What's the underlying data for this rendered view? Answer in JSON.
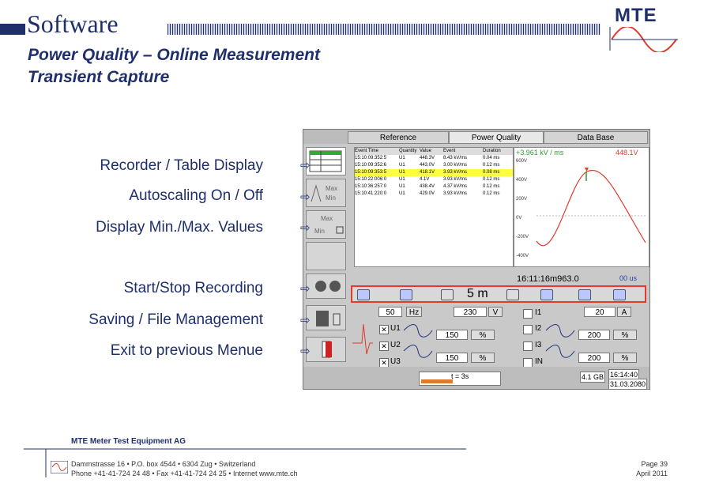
{
  "header": {
    "title": "Software",
    "subtitle_1": "Power Quality – Online Measurement",
    "subtitle_2": "Transient Capture",
    "logo_text": "MTE"
  },
  "feature_labels": [
    "Recorder / Table Display",
    "Autoscaling On / Off",
    "Display Min./Max. Values",
    "Start/Stop Recording",
    "Saving / File Management",
    "Exit to previous Menue"
  ],
  "screen": {
    "tabs": [
      "Reference",
      "Power Quality",
      "Data Base"
    ],
    "table": {
      "headers": [
        "Event Time",
        "Quantity",
        "Value",
        "Event",
        "Duration"
      ],
      "rows": [
        [
          "15:10:09:352:5",
          "U1",
          "448.3V",
          "8.43 kV/ms",
          "0.04 ms"
        ],
        [
          "15:10:09:352:6",
          "U1",
          "443.0V",
          "3.00 kV/ms",
          "0.12 ms"
        ],
        [
          "15:10:09:353:5",
          "U1",
          "418.1V",
          "3.93 kV/ms",
          "0.08 ms"
        ],
        [
          "15:10:22:006:0",
          "U1",
          "4.1V",
          "3.93 kV/ms",
          "0.12 ms"
        ],
        [
          "15:10:36:257:0",
          "U1",
          "438.4V",
          "4.37 kV/ms",
          "0.12 ms"
        ],
        [
          "15:10:41:220:0",
          "U1",
          "429.0V",
          "3.93 kV/ms",
          "0.12 ms"
        ]
      ]
    },
    "scope": {
      "rate_label": "+3.961 kV / ms",
      "peak_label": "448.1V",
      "yticks": [
        "600V",
        "400V",
        "200V",
        "0V",
        "-200V",
        "-400V",
        "-600V"
      ],
      "time": "16:11:16m963.0",
      "span": "00 us"
    },
    "control_value": "5 m",
    "params": {
      "top_left_value": "50",
      "top_left_unit": "Hz",
      "voltage_value": "230",
      "voltage_unit": "V",
      "current_value": "20",
      "current_unit": "A",
      "rows": [
        {
          "v_label": "U1",
          "v_value": "150",
          "v_unit": "%",
          "i_label": "I1",
          "i_value": "200",
          "i_unit": "%"
        },
        {
          "v_label": "U2",
          "v_value": "150",
          "v_unit": "%",
          "i_label": "I2",
          "i_value": "200",
          "i_unit": "%"
        },
        {
          "v_label": "U3",
          "v_value": "",
          "v_unit": "",
          "i_label": "IN",
          "i_value": "",
          "i_unit": ""
        }
      ],
      "check_i_labels": [
        "I1",
        "I2",
        "I3",
        "IN"
      ]
    },
    "status": {
      "timer": "t = 3s",
      "storage": "4.1 GB",
      "clock_time": "16:14:40",
      "clock_date": "31.03.2080"
    }
  },
  "footer": {
    "company": "MTE Meter Test Equipment AG",
    "address_1": "Dammstrasse 16 • P.O. box 4544 • 6304 Zug • Switzerland",
    "address_2": "Phone +41-41-724 24 48 • Fax +41-41-724 24 25 • Internet www.mte.ch",
    "page": "Page 39",
    "date": "April 2011"
  },
  "colors": {
    "brand": "#1f2f6b",
    "highlight": "#e23a2c",
    "waveform": "#e23a2c"
  }
}
